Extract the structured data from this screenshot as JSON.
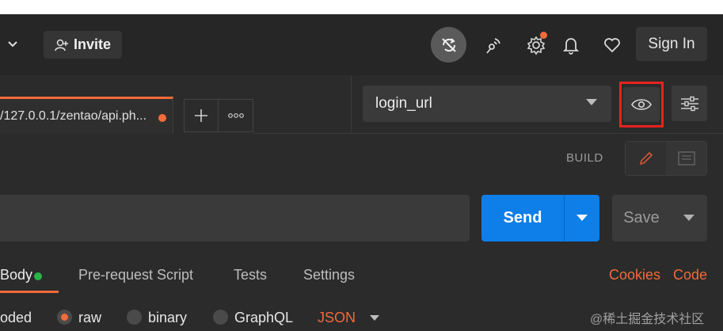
{
  "header": {
    "invite_label": "Invite",
    "signin_label": "Sign In"
  },
  "tab": {
    "url": "/127.0.0.1/zentao/api.ph..."
  },
  "environment": {
    "selected": "login_url"
  },
  "build_label": "BUILD",
  "request": {
    "send_label": "Send",
    "save_label": "Save"
  },
  "subtabs": {
    "body": "Body",
    "prerequest": "Pre-request Script",
    "tests": "Tests",
    "settings": "Settings",
    "cookies": "Cookies",
    "code": "Code"
  },
  "body_options": {
    "encoded": "oded",
    "raw": "raw",
    "binary": "binary",
    "graphql": "GraphQL",
    "json": "JSON"
  },
  "watermark": "@稀土掘金技术社区",
  "colors": {
    "accent_orange": "#f26b3a",
    "send_blue": "#0e7ee8",
    "highlight_red": "#e8221f",
    "status_green": "#28b446"
  }
}
